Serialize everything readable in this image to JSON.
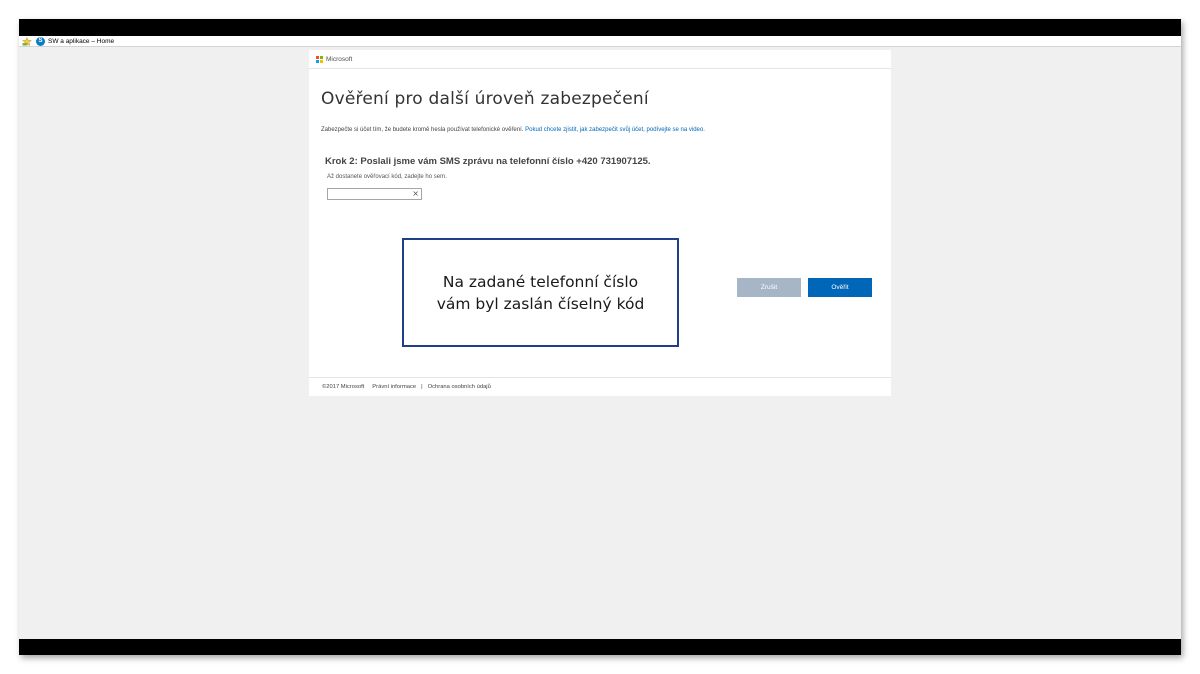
{
  "favorites_bar": {
    "item_label": "SW a aplikace – Home",
    "icons": [
      "favorites-star-icon",
      "sharepoint-icon"
    ],
    "sharepoint_glyph": "S"
  },
  "header": {
    "brand": "Microsoft",
    "logo_colors": [
      "#f25022",
      "#7fba00",
      "#00a4ef",
      "#ffb900"
    ]
  },
  "main": {
    "title": "Ověření pro další úroveň zabezpečení",
    "intro_text": "Zabezpečte si účet tím, že budete kromě hesla používat telefonické ověření.",
    "intro_link": "Pokud chcete zjistit, jak zabezpečit svůj účet, podívejte se na video.",
    "step_text": "Krok 2: Poslali jsme vám SMS zprávu na telefonní číslo +420 731907125.",
    "hint_text": "Až dostanete ověřovací kód, zadejte ho sem.",
    "code_input": {
      "value": "",
      "clear_glyph": "×"
    }
  },
  "callout": {
    "line1": "Na zadané telefonní číslo",
    "line2": "vám byl zaslán číselný kód"
  },
  "buttons": {
    "cancel_label": "Zrušit",
    "verify_label": "Ověřit",
    "cancel_color": "#a7b6c6",
    "verify_color": "#0067b8"
  },
  "footer": {
    "copyright": "©2017 Microsoft",
    "legal_link": "Právní informace",
    "separator": "|",
    "privacy_link": "Ochrana osobních údajů"
  }
}
